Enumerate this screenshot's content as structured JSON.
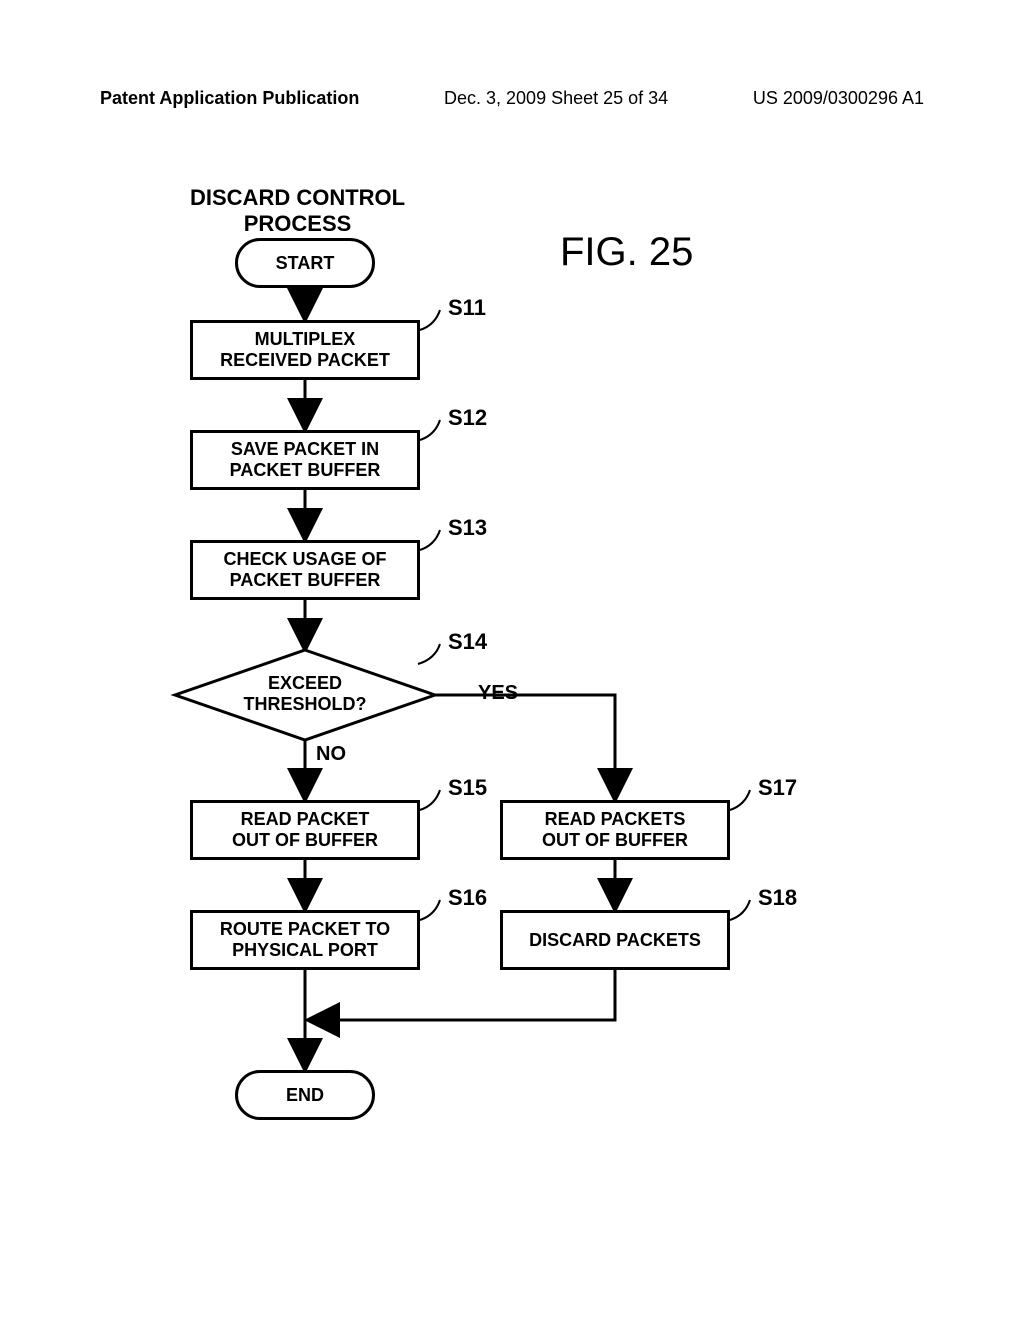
{
  "header": {
    "left": "Patent Application Publication",
    "center": "Dec. 3, 2009  Sheet 25 of 34",
    "right": "US 2009/0300296 A1"
  },
  "title_line1": "DISCARD CONTROL",
  "title_line2": "PROCESS",
  "figure_label": "FIG. 25",
  "nodes": {
    "start": "START",
    "s11": "MULTIPLEX\nRECEIVED PACKET",
    "s12": "SAVE PACKET IN\nPACKET BUFFER",
    "s13": "CHECK USAGE OF\nPACKET BUFFER",
    "s14": "EXCEED\nTHRESHOLD?",
    "s15": "READ PACKET\nOUT OF BUFFER",
    "s16": "ROUTE PACKET TO\nPHYSICAL PORT",
    "s17": "READ PACKETS\nOUT OF BUFFER",
    "s18": "DISCARD PACKETS",
    "end": "END"
  },
  "step_labels": {
    "s11": "S11",
    "s12": "S12",
    "s13": "S13",
    "s14": "S14",
    "s15": "S15",
    "s16": "S16",
    "s17": "S17",
    "s18": "S18"
  },
  "branches": {
    "yes": "YES",
    "no": "NO"
  }
}
